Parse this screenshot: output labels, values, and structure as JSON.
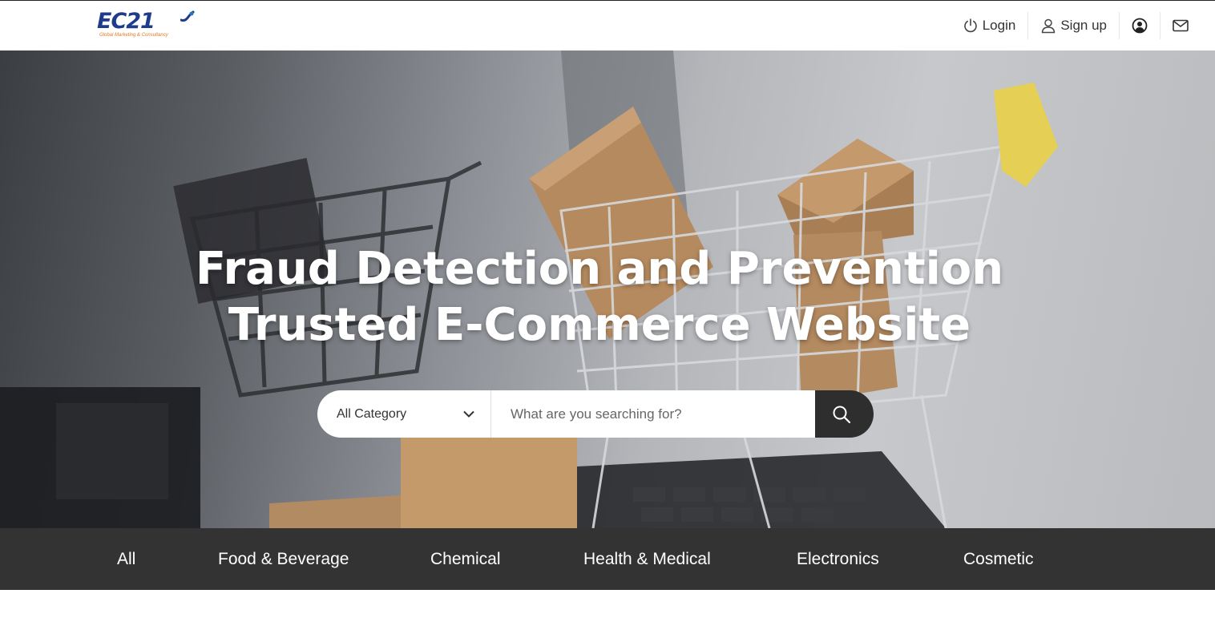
{
  "header": {
    "logo": {
      "text": "EC21",
      "tagline": "Global Marketing & Consultancy"
    },
    "nav": [
      {
        "label": "Login",
        "icon": "power-icon"
      },
      {
        "label": "Sign up",
        "icon": "user-icon"
      },
      {
        "label": "",
        "icon": "account-circle-icon"
      },
      {
        "label": "",
        "icon": "mail-icon"
      }
    ]
  },
  "hero": {
    "title_line1": "Fraud Detection and Prevention",
    "title_line2": "Trusted E-Commerce Website",
    "search": {
      "category_selected": "All Category",
      "placeholder": "What are you searching for?"
    }
  },
  "categories": [
    "All",
    "Food & Beverage",
    "Chemical",
    "Health & Medical",
    "Electronics",
    "Cosmetic"
  ],
  "colors": {
    "brand": "#1f3c8c",
    "accent": "#e07a1f",
    "dark_bar": "#333333",
    "search_button": "#2e2e2e"
  }
}
